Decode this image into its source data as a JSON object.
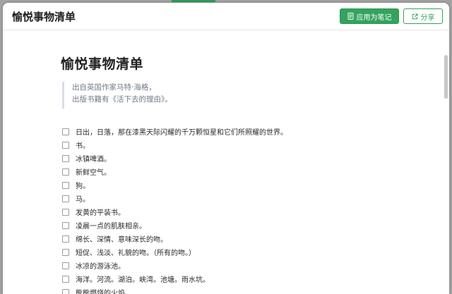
{
  "header": {
    "title": "愉悦事物清单",
    "apply_note_label": "应用为笔记",
    "share_label": "分享",
    "apply_icon": "note-icon",
    "share_icon": "share-icon"
  },
  "doc": {
    "title": "愉悦事物清单",
    "quote": [
      "出自英国作家马特·海格，",
      "出版书籍有《活下去的理由》。"
    ],
    "items": [
      "日出，日落，那在漆黑天际闪耀的千万颗恒星和它们所照耀的世界。",
      "书。",
      "冰镇啤酒。",
      "新鲜空气。",
      "狗。",
      "马。",
      "发黄的平装书。",
      "凌晨一点的肌肤相亲。",
      "绵长、深情、意味深长的吻。",
      "短促、浅淡、礼貌的吻。（所有的吻。）",
      "冰凉的游泳池。",
      "海洋。河流。湖泊。峡湾。池塘。雨水坑。",
      "熊熊燃烧的火焰"
    ]
  },
  "colors": {
    "accent_green": "#34a35d",
    "quote_border": "#d8dde6",
    "quote_text": "#6f7a89"
  }
}
